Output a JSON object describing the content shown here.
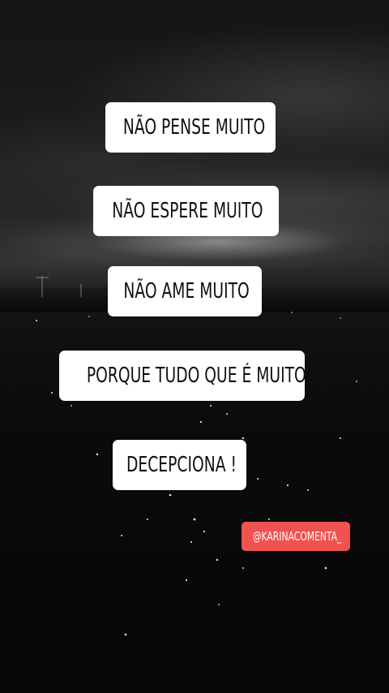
{
  "story": {
    "lines": [
      "NÃO PENSE MUITO",
      "NÃO ESPERE MUITO",
      "NÃO AME MUITO",
      "PORQUE TUDO QUE É MUITO",
      "DECEPCIONA !"
    ],
    "mention": "@KARINACOMENTA_"
  },
  "colors": {
    "background": "#0a0a0a",
    "pill": "#ffffff",
    "pill_text": "#111111",
    "mention_bg": "#f0534f",
    "mention_text": "#ffffff"
  }
}
